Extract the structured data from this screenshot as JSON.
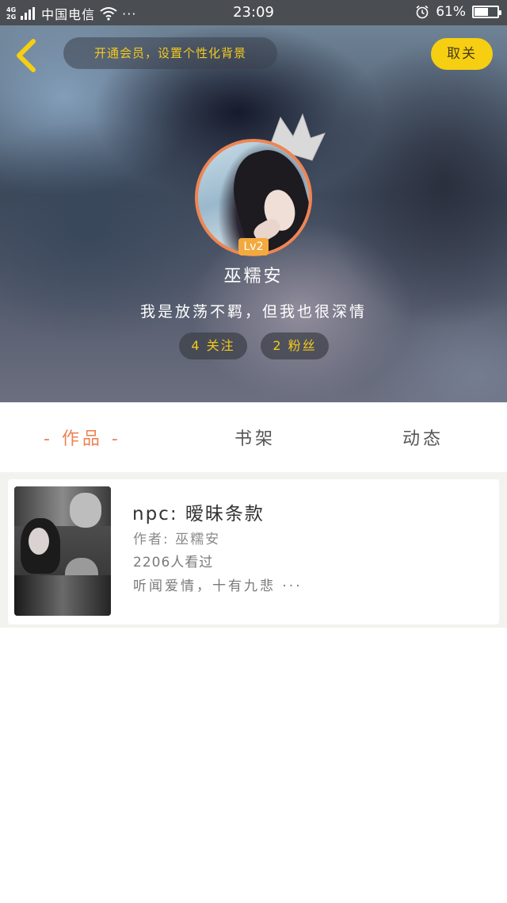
{
  "status_bar": {
    "network_top": "4G",
    "network_bottom": "2G",
    "carrier": "中国电信",
    "dots": "···",
    "time": "23:09",
    "battery": "61%",
    "battery_level": 0.61
  },
  "header": {
    "member_banner": "开通会员，设置个性化背景",
    "cancel_label": "取关"
  },
  "profile": {
    "level": "Lv2",
    "username": "巫糯安",
    "signature": "我是放荡不羁，但我也很深情",
    "following": "4 关注",
    "fans": "2 粉丝"
  },
  "tabs": [
    {
      "label": "- 作品 -",
      "active": true
    },
    {
      "label": "书架",
      "active": false
    },
    {
      "label": "动态",
      "active": false
    }
  ],
  "works": [
    {
      "title": "npc: 暧昧条款",
      "author": "作者: 巫糯安",
      "views": "2206人看过",
      "desc": "听闻爱情，十有九悲 ···"
    }
  ],
  "colors": {
    "accent_orange": "#ee8254",
    "accent_yellow": "#f6cf12",
    "banner_text": "#f4c91e",
    "avatar_border": "#ef8553"
  },
  "icons": {
    "back": "chevron-left-icon",
    "crown": "crown-icon",
    "wifi": "wifi-icon",
    "alarm": "alarm-icon",
    "battery": "battery-icon",
    "signal": "signal-icon"
  }
}
